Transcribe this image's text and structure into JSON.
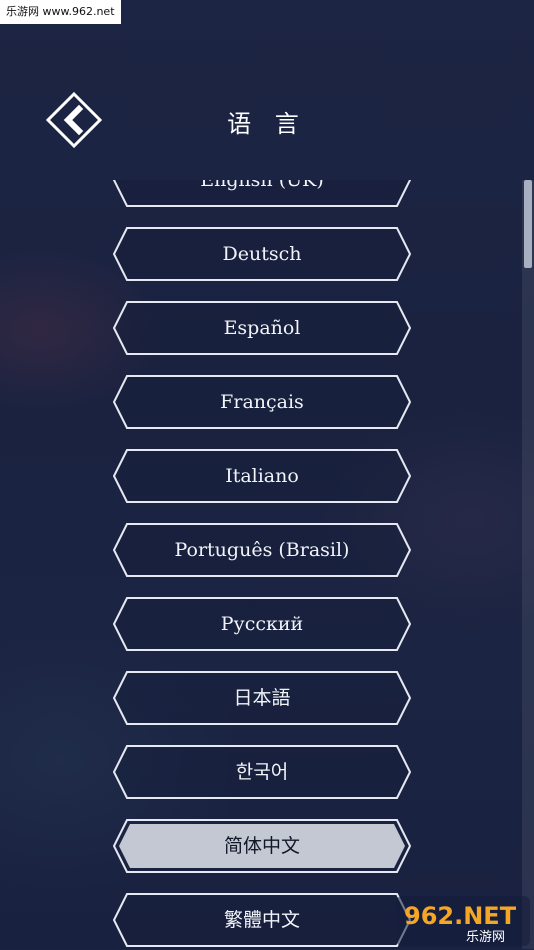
{
  "watermark_top": "乐游网 www.962.net",
  "header": {
    "title": "语 言",
    "back_icon": "chevron-left-icon"
  },
  "languages": [
    {
      "label": "English (UK)",
      "selected": false
    },
    {
      "label": "Deutsch",
      "selected": false
    },
    {
      "label": "Español",
      "selected": false
    },
    {
      "label": "Français",
      "selected": false
    },
    {
      "label": "Italiano",
      "selected": false
    },
    {
      "label": "Português (Brasil)",
      "selected": false
    },
    {
      "label": "Русский",
      "selected": false
    },
    {
      "label": "日本語",
      "selected": false
    },
    {
      "label": "한국어",
      "selected": false
    },
    {
      "label": "简体中文",
      "selected": true
    },
    {
      "label": "繁體中文",
      "selected": false
    }
  ],
  "watermark_bottom": {
    "main": "962.NET",
    "sub": "乐游网"
  },
  "colors": {
    "background": "#1a2341",
    "border": "#e6e9f2",
    "selected_fill": "#c4c8d2",
    "text": "#f2f4fa"
  }
}
